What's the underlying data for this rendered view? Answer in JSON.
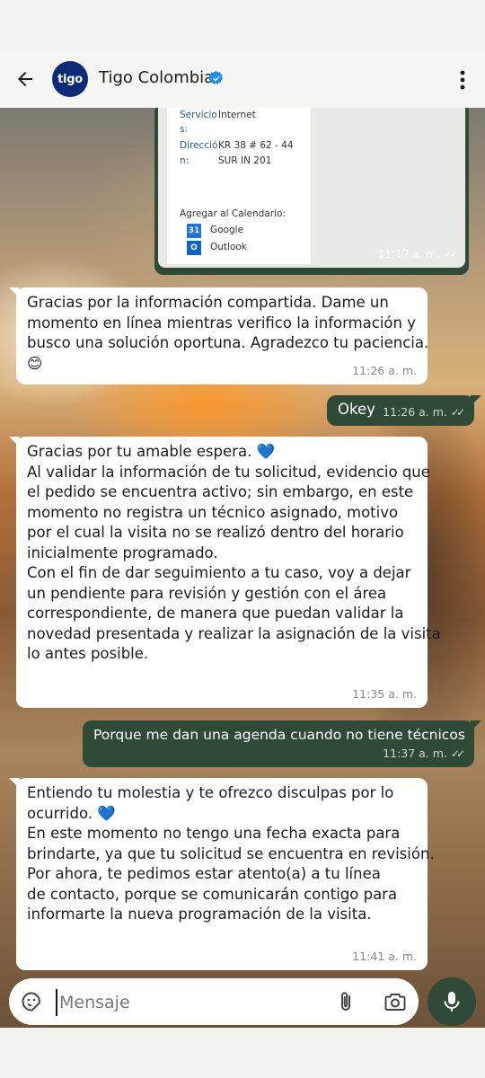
{
  "header": {
    "contact_name": "Tigo Colombia",
    "avatar_text": "tigo",
    "brand_color": "#0c2a78",
    "verified_color": "#1d8ef0"
  },
  "media": {
    "rows": [
      {
        "key": "Servicio",
        "value": "Internet"
      },
      {
        "key": "s:",
        "value": ""
      },
      {
        "key": "Direcció",
        "value": "KR 38 # 62 - 44"
      },
      {
        "key": "n:",
        "value": "SUR IN 201"
      }
    ],
    "calendar_label": "Agregar al Calendario:",
    "google_label": "Google",
    "google_icon_text": "31",
    "outlook_label": "Outlook",
    "outlook_icon_text": "O",
    "time": "11:17 a. m."
  },
  "messages": {
    "m1": {
      "lines": [
        "Gracias por la información compartida. Dame un",
        "momento en línea mientras verifico la información y",
        "busco una solución oportuna. Agradezco tu paciencia.",
        "😊"
      ],
      "time": "11:26 a. m."
    },
    "m2": {
      "text": "Okey",
      "time": "11:26 a. m."
    },
    "m3": {
      "lines": [
        "Gracias por tu amable espera. 💙",
        "",
        "Al validar la información de tu solicitud, evidencio que",
        "el pedido se encuentra activo; sin embargo, en este",
        "momento no registra un técnico asignado, motivo",
        "por el cual la visita no se realizó dentro del horario",
        "inicialmente programado.",
        "",
        "Con el fin de dar seguimiento a tu caso, voy a dejar",
        "un pendiente para revisión y gestión con el área",
        "correspondiente, de manera que puedan validar la",
        "novedad presentada y realizar la asignación de la visita",
        "lo antes posible."
      ],
      "time": "11:35 a. m."
    },
    "m4": {
      "text": "Porque me dan una agenda cuando no tiene técnicos",
      "time": "11:37 a. m."
    },
    "m5": {
      "lines": [
        "Entiendo tu molestia y te ofrezco disculpas por lo",
        "ocurrido. 💙",
        "",
        "En este momento no tengo una fecha exacta para",
        "brindarte, ya que tu solicitud se encuentra en revisión.",
        "Por ahora, te pedimos estar atento(a) a tu línea",
        "de contacto, porque se comunicarán contigo para",
        "informarte la nueva programación de la visita."
      ],
      "time": "11:41 a. m."
    }
  },
  "composer": {
    "placeholder": "Mensaje",
    "value": ""
  },
  "icons": {
    "back": "arrow-left-icon",
    "verified": "verified-badge-icon",
    "menu": "more-vert-icon",
    "emoji": "sticker-icon",
    "attach": "paperclip-icon",
    "camera": "camera-icon",
    "mic": "mic-icon",
    "read_ticks": "double-check-icon"
  },
  "colors": {
    "outgoing_bubble": "#2f4a36",
    "incoming_bubble": "#ffffff"
  }
}
